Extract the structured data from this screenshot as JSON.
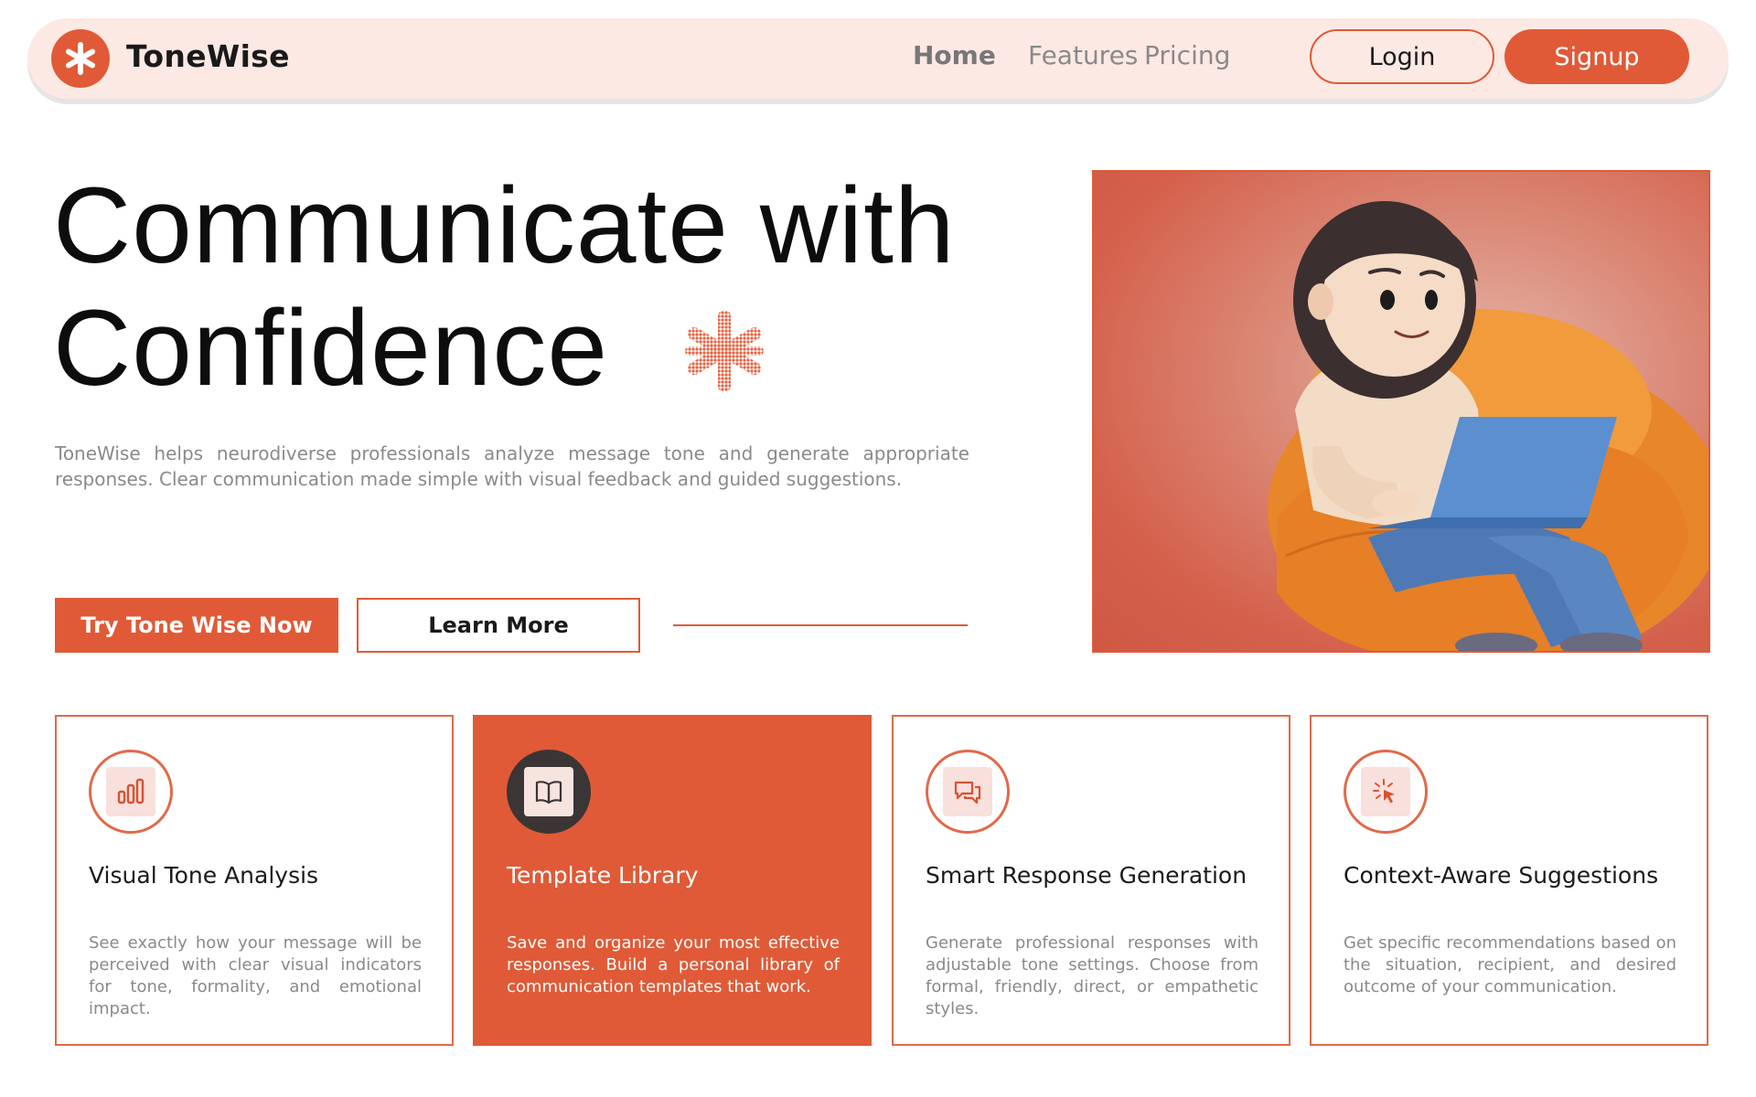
{
  "brand": {
    "name": "ToneWise",
    "accent_color": "#e05a37",
    "logo_icon": "asterisk-icon"
  },
  "nav": {
    "links": [
      {
        "label": "Home",
        "active": true
      },
      {
        "label": "Features",
        "active": false
      },
      {
        "label": "Pricing",
        "active": false
      }
    ],
    "login_label": "Login",
    "signup_label": "Signup"
  },
  "hero": {
    "title_line1": "Communicate with",
    "title_line2": "Confidence",
    "description": "ToneWise helps neurodiverse professionals analyze message tone and generate appropriate responses. Clear communication made simple with visual feedback and guided suggestions.",
    "primary_cta": "Try Tone Wise Now",
    "secondary_cta": "Learn More",
    "image_icon": "illustration-person-laptop-beanbag"
  },
  "features": [
    {
      "title": "Visual Tone Analysis",
      "description": "See exactly how your message will be perceived with clear visual indicators for tone, formality, and emotional impact.",
      "icon": "bar-chart-icon",
      "highlighted": false
    },
    {
      "title": "Template Library",
      "description": "Save and organize your most effective responses. Build a personal library of communication templates that work.",
      "icon": "book-open-icon",
      "highlighted": true
    },
    {
      "title": "Smart Response Generation",
      "description": "Generate professional responses with adjustable tone settings. Choose from formal, friendly, direct, or empathetic styles.",
      "icon": "chat-bubbles-icon",
      "highlighted": false
    },
    {
      "title": "Context-Aware Suggestions",
      "description": "Get specific recommendations based on the situation, recipient, and desired outcome of your communication.",
      "icon": "cursor-click-icon",
      "highlighted": false
    }
  ]
}
